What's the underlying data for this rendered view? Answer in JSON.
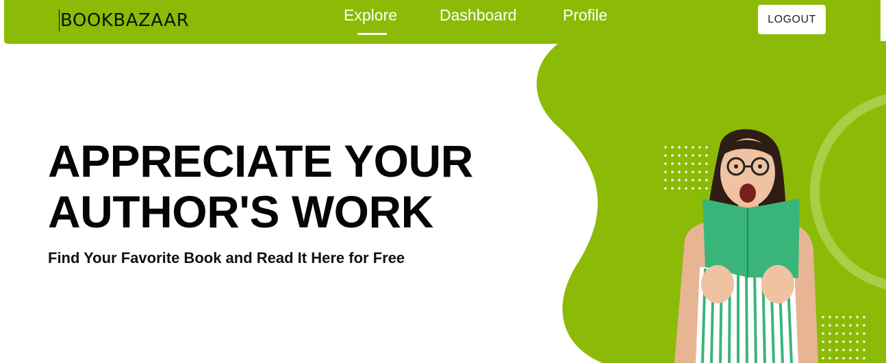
{
  "nav": {
    "brand": "BOOKBAZAAR",
    "links": [
      {
        "label": "Explore",
        "active": true
      },
      {
        "label": "Dashboard",
        "active": false
      },
      {
        "label": "Profile",
        "active": false
      }
    ],
    "logout_label": "LOGOUT"
  },
  "hero": {
    "title_line1": "APPRECIATE YOUR",
    "title_line2": "AUTHOR'S WORK",
    "subtitle": "Find Your Favorite Book and Read It Here for Free",
    "illustration": "woman-reading-book-illustration"
  },
  "colors": {
    "accent": "#8cbb07",
    "book": "#3ab57a",
    "text": "#050505"
  }
}
